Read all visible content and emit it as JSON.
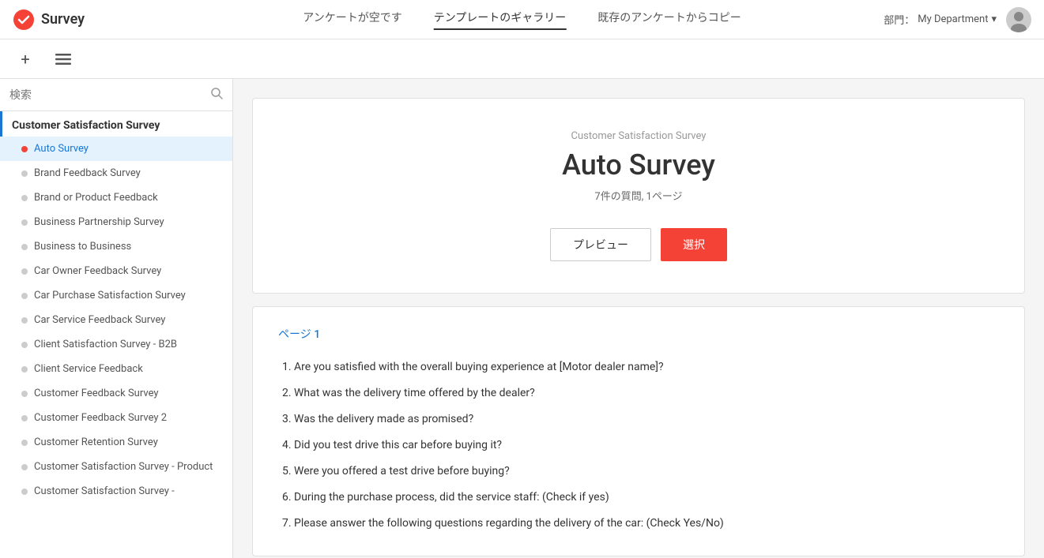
{
  "header": {
    "logo_text": "Survey",
    "tabs": [
      {
        "id": "empty",
        "label": "アンケートが空です",
        "active": false
      },
      {
        "id": "gallery",
        "label": "テンプレートのギャラリー",
        "active": true
      },
      {
        "id": "copy",
        "label": "既存のアンケートからコピー",
        "active": false
      }
    ],
    "dept_label": "部門：",
    "dept_name": "My Department"
  },
  "search": {
    "placeholder": "検索"
  },
  "sidebar": {
    "group_label": "Customer Satisfaction Survey",
    "items": [
      {
        "label": "Auto Survey",
        "active": true
      },
      {
        "label": "Brand Feedback Survey",
        "active": false
      },
      {
        "label": "Brand or Product Feedback",
        "active": false
      },
      {
        "label": "Business Partnership Survey",
        "active": false
      },
      {
        "label": "Business to Business",
        "active": false
      },
      {
        "label": "Car Owner Feedback Survey",
        "active": false
      },
      {
        "label": "Car Purchase Satisfaction Survey",
        "active": false
      },
      {
        "label": "Car Service Feedback Survey",
        "active": false
      },
      {
        "label": "Client Satisfaction Survey - B2B",
        "active": false
      },
      {
        "label": "Client Service Feedback",
        "active": false
      },
      {
        "label": "Customer Feedback Survey",
        "active": false
      },
      {
        "label": "Customer Feedback Survey 2",
        "active": false
      },
      {
        "label": "Customer Retention Survey",
        "active": false
      },
      {
        "label": "Customer Satisfaction Survey - Product",
        "active": false
      },
      {
        "label": "Customer Satisfaction Survey -",
        "active": false
      }
    ]
  },
  "preview": {
    "category": "Customer Satisfaction Survey",
    "title": "Auto Survey",
    "meta": "7件の質問, 1ページ",
    "btn_preview": "プレビュー",
    "btn_select": "選択"
  },
  "questions": {
    "page_label": "ページ 1",
    "items": [
      "Are you satisfied with the overall buying experience at [Motor dealer name]?",
      "What was the delivery time offered by the dealer?",
      "Was the delivery made as promised?",
      "Did you test drive this car before buying it?",
      "Were you offered a test drive before buying?",
      "During the purchase process, did the service staff: (Check if yes)",
      "Please answer the following questions regarding the delivery of the car: (Check Yes/No)"
    ]
  }
}
